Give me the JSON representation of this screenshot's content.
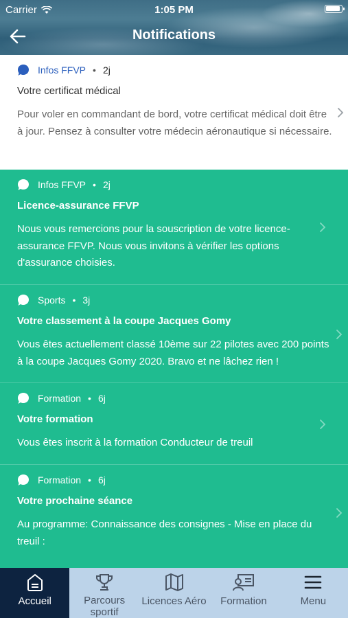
{
  "status": {
    "carrier": "Carrier",
    "time": "1:05 PM"
  },
  "nav": {
    "title": "Notifications"
  },
  "notifications": [
    {
      "category": "Infos FFVP",
      "age": "2j",
      "title": "Votre certificat médical",
      "body": "Pour voler en commandant de bord, votre certificat médical doit être à jour. Pensez à consulter votre médecin aéronautique si nécessaire.",
      "read": true
    },
    {
      "category": "Infos FFVP",
      "age": "2j",
      "title": "Licence-assurance FFVP",
      "body": "Nous vous remercions pour la souscription de votre licence-assurance FFVP. Nous vous invitons à vérifier les options d'assurance choisies.",
      "read": false
    },
    {
      "category": "Sports",
      "age": "3j",
      "title": "Votre classement à la coupe Jacques Gomy",
      "body": "Vous êtes actuellement classé 10ème sur 22 pilotes avec 200 points à la coupe Jacques Gomy 2020. Bravo et ne lâchez rien !",
      "read": false
    },
    {
      "category": "Formation",
      "age": "6j",
      "title": "Votre formation",
      "body": "Vous êtes inscrit à la formation Conducteur de treuil",
      "read": false
    },
    {
      "category": "Formation",
      "age": "6j",
      "title": "Votre prochaine séance",
      "body": "Au programme: Connaissance des consignes - Mise en place du treuil :",
      "read": false
    }
  ],
  "separator": "•",
  "tabs": [
    {
      "label": "Accueil",
      "icon": "home-icon",
      "active": true
    },
    {
      "label": "Parcours sportif",
      "icon": "trophy-icon",
      "active": false
    },
    {
      "label": "Licences Aéro",
      "icon": "map-icon",
      "active": false
    },
    {
      "label": "Formation",
      "icon": "id-card-icon",
      "active": false
    },
    {
      "label": "Menu",
      "icon": "hamburger-icon",
      "active": false
    }
  ],
  "colors": {
    "accent_green": "#1fbc90",
    "tab_active": "#0d2340",
    "tab_bar": "#bcd3e9",
    "category_blue": "#2b5fbd"
  }
}
